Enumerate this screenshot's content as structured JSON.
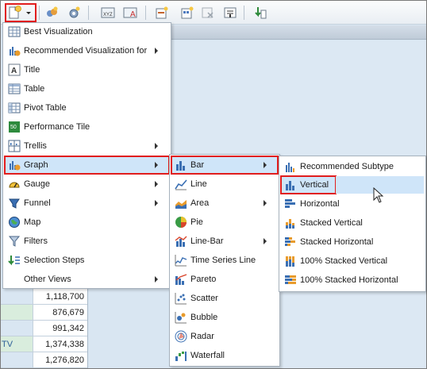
{
  "background": {
    "table_rows": [
      {
        "label": "",
        "value": "1,118,700"
      },
      {
        "label": "",
        "value": "876,679"
      },
      {
        "label": "",
        "value": "991,342"
      },
      {
        "label": "TV",
        "value": "1,374,338"
      },
      {
        "label": "",
        "value": "1,276,820"
      }
    ]
  },
  "menu1": {
    "items": [
      {
        "label": "Best Visualization",
        "icon": "best-visualization-icon",
        "submenu": false
      },
      {
        "label": "Recommended Visualization for",
        "icon": "recommended-visualization-icon",
        "submenu": true
      },
      {
        "label": "Title",
        "icon": "title-icon",
        "submenu": false
      },
      {
        "label": "Table",
        "icon": "table-icon",
        "submenu": false
      },
      {
        "label": "Pivot Table",
        "icon": "pivot-table-icon",
        "submenu": false
      },
      {
        "label": "Performance Tile",
        "icon": "performance-tile-icon",
        "icon_text": "50",
        "submenu": false
      },
      {
        "label": "Trellis",
        "icon": "trellis-icon",
        "submenu": true
      },
      {
        "label": "Graph",
        "icon": "graph-icon",
        "submenu": true,
        "selected": true
      },
      {
        "label": "Gauge",
        "icon": "gauge-icon",
        "submenu": true
      },
      {
        "label": "Funnel",
        "icon": "funnel-icon",
        "submenu": true
      },
      {
        "label": "Map",
        "icon": "map-icon",
        "submenu": false
      },
      {
        "label": "Filters",
        "icon": "filters-icon",
        "submenu": false
      },
      {
        "label": "Selection Steps",
        "icon": "selection-steps-icon",
        "submenu": false
      },
      {
        "label": "Other Views",
        "icon": "",
        "submenu": true
      }
    ]
  },
  "menu2": {
    "items": [
      {
        "label": "Bar",
        "icon": "bar-chart-icon",
        "submenu": true,
        "selected": true
      },
      {
        "label": "Line",
        "icon": "line-chart-icon",
        "submenu": false
      },
      {
        "label": "Area",
        "icon": "area-chart-icon",
        "submenu": true
      },
      {
        "label": "Pie",
        "icon": "pie-chart-icon",
        "submenu": false
      },
      {
        "label": "Line-Bar",
        "icon": "line-bar-chart-icon",
        "submenu": true
      },
      {
        "label": "Time Series Line",
        "icon": "time-series-line-icon",
        "submenu": false
      },
      {
        "label": "Pareto",
        "icon": "pareto-chart-icon",
        "submenu": false
      },
      {
        "label": "Scatter",
        "icon": "scatter-chart-icon",
        "submenu": false
      },
      {
        "label": "Bubble",
        "icon": "bubble-chart-icon",
        "submenu": false
      },
      {
        "label": "Radar",
        "icon": "radar-chart-icon",
        "submenu": false
      },
      {
        "label": "Waterfall",
        "icon": "waterfall-chart-icon",
        "submenu": false
      }
    ]
  },
  "menu3": {
    "items": [
      {
        "label": "Recommended Subtype",
        "icon": "recommended-subtype-icon"
      },
      {
        "label": "Vertical",
        "icon": "vertical-bar-icon",
        "selected": true
      },
      {
        "label": "Horizontal",
        "icon": "horizontal-bar-icon"
      },
      {
        "label": "Stacked Vertical",
        "icon": "stacked-vertical-bar-icon"
      },
      {
        "label": "Stacked Horizontal",
        "icon": "stacked-horizontal-bar-icon"
      },
      {
        "label": "100% Stacked Vertical",
        "icon": "percent-stacked-vertical-bar-icon"
      },
      {
        "label": "100% Stacked Horizontal",
        "icon": "percent-stacked-horizontal-bar-icon"
      }
    ]
  },
  "colors": {
    "highlight_border": "#e11d1d",
    "selected_bg": "#cfe5f9",
    "menu_bg": "#ffffff"
  }
}
